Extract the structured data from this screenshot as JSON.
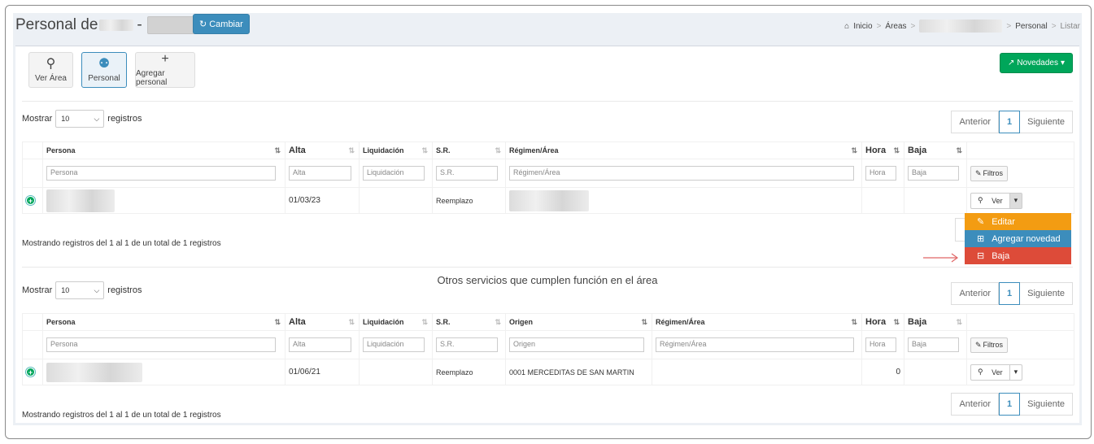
{
  "header": {
    "title_prefix": "Personal de",
    "title_dash": "-",
    "cambiar_label": "Cambiar",
    "breadcrumb": [
      "Inicio",
      "Áreas",
      "Personal",
      "Listar"
    ]
  },
  "toolbar": {
    "ver_area_label": "Ver Área",
    "personal_label": "Personal",
    "agregar_personal_label": "Agregar personal",
    "novedades_label": "Novedades"
  },
  "table1": {
    "mostrar_label": "Mostrar",
    "page_size": "10",
    "registros_label": "registros",
    "pager": {
      "prev": "Anterior",
      "page": "1",
      "next": "Siguiente"
    },
    "columns": [
      "Persona",
      "Alta",
      "Liquidación",
      "S.R.",
      "Régimen/Área",
      "Hora",
      "Baja"
    ],
    "filters": {
      "persona": "Persona",
      "alta": "Alta",
      "liquidacion": "Liquidación",
      "sr": "S.R.",
      "regimen": "Régimen/Área",
      "hora": "Hora",
      "baja": "Baja"
    },
    "filtros_label": "Filtros",
    "row": {
      "alta": "01/03/23",
      "liquidacion": "",
      "sr": "Reemplazo",
      "hora": "",
      "baja": ""
    },
    "ver_label": "Ver",
    "info": "Mostrando registros del 1 al 1 de un total de 1 registros"
  },
  "dropdown": {
    "items": [
      {
        "label": "Editar",
        "color": "#f39c12",
        "icon": "pencil-icon"
      },
      {
        "label": "Agregar novedad",
        "color": "#3c8dbc",
        "icon": "calendar-plus-icon"
      },
      {
        "label": "Baja",
        "color": "#dd4b39",
        "icon": "calendar-minus-icon"
      }
    ]
  },
  "section2": {
    "title": "Otros servicios que cumplen función en el área"
  },
  "table2": {
    "mostrar_label": "Mostrar",
    "page_size": "10",
    "registros_label": "registros",
    "pager": {
      "prev": "Anterior",
      "page": "1",
      "next": "Siguiente"
    },
    "columns": [
      "Persona",
      "Alta",
      "Liquidación",
      "S.R.",
      "Origen",
      "Régimen/Área",
      "Hora",
      "Baja"
    ],
    "filters": {
      "persona": "Persona",
      "alta": "Alta",
      "liquidacion": "Liquidación",
      "sr": "S.R.",
      "origen": "Origen",
      "regimen": "Régimen/Área",
      "hora": "Hora",
      "baja": "Baja"
    },
    "filtros_label": "Filtros",
    "row": {
      "alta": "01/06/21",
      "liquidacion": "",
      "sr": "Reemplazo",
      "origen": "0001 MERCEDITAS DE SAN MARTIN",
      "regimen": "",
      "hora": "0",
      "baja": ""
    },
    "ver_label": "Ver",
    "info": "Mostrando registros del 1 al 1 de un total de 1 registros"
  },
  "colors": {
    "primary": "#3c8dbc",
    "success": "#00a65a",
    "warning": "#f39c12",
    "danger": "#dd4b39"
  }
}
